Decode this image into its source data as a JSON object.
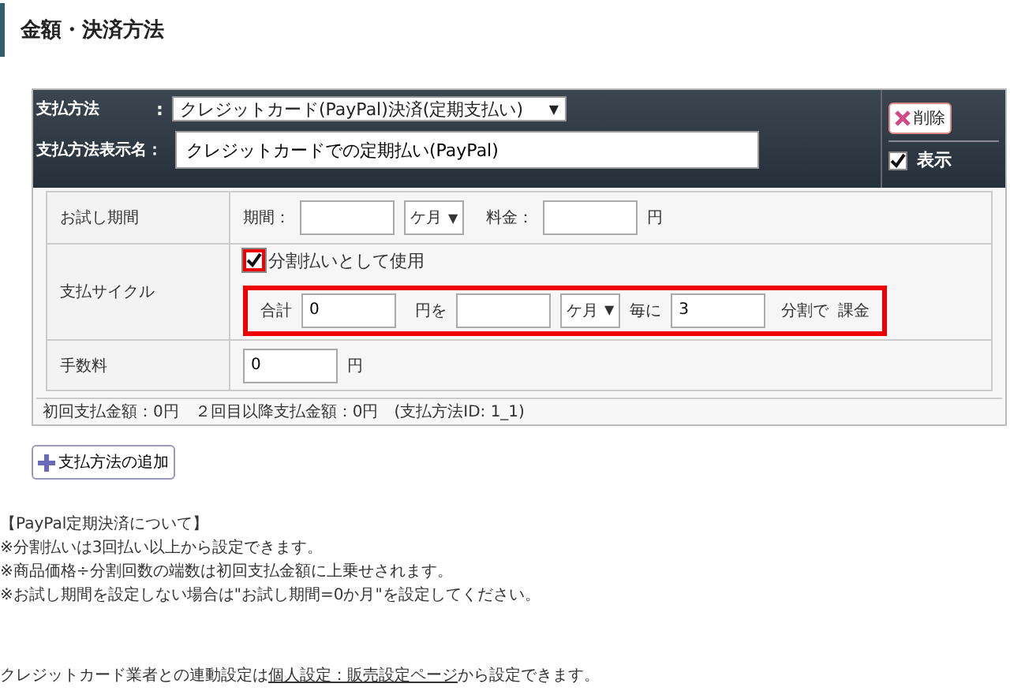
{
  "section_title": "金額・決済方法",
  "payment_method": {
    "label": "支払方法",
    "colon": ":",
    "value": "クレジットカード(PayPal)決済(定期支払い)",
    "caret": "▼"
  },
  "display_name": {
    "label": "支払方法表示名：",
    "value": "クレジットカードでの定期払い(PayPal)"
  },
  "delete_button": "削除",
  "show": {
    "label": "表示",
    "checked": true
  },
  "trial": {
    "label": "お試し期間",
    "period_label": "期間：",
    "unit": "ケ月",
    "caret": "▼",
    "fee_label": "料金：",
    "yen": "円"
  },
  "cycle": {
    "label": "支払サイクル",
    "installment": {
      "label": "分割払いとして使用",
      "checked": true
    },
    "total_label": "合計",
    "total_value": "0",
    "yen_wo": "円を",
    "unit": "ケ月",
    "caret": "▼",
    "every": "毎に",
    "count_value": "3",
    "split": "分割で",
    "charge": "課金"
  },
  "fee": {
    "label": "手数料",
    "value": "0",
    "yen": "円"
  },
  "summary": "初回支払金額：0円　２回目以降支払金額：0円　(支払方法ID: 1_1)",
  "add_button": "支払方法の追加",
  "notes": [
    "【PayPal定期決済について】",
    "※分割払いは3回払い以上から設定できます。",
    "※商品価格÷分割回数の端数は初回支払金額に上乗せされます。",
    "※お試し期間を設定しない場合は\"お試し期間=0か月\"を設定してください。"
  ],
  "footer": {
    "before": "クレジットカード業者との連動設定は",
    "link": "個人設定：販売設定ページ",
    "after": "から設定できます。"
  }
}
